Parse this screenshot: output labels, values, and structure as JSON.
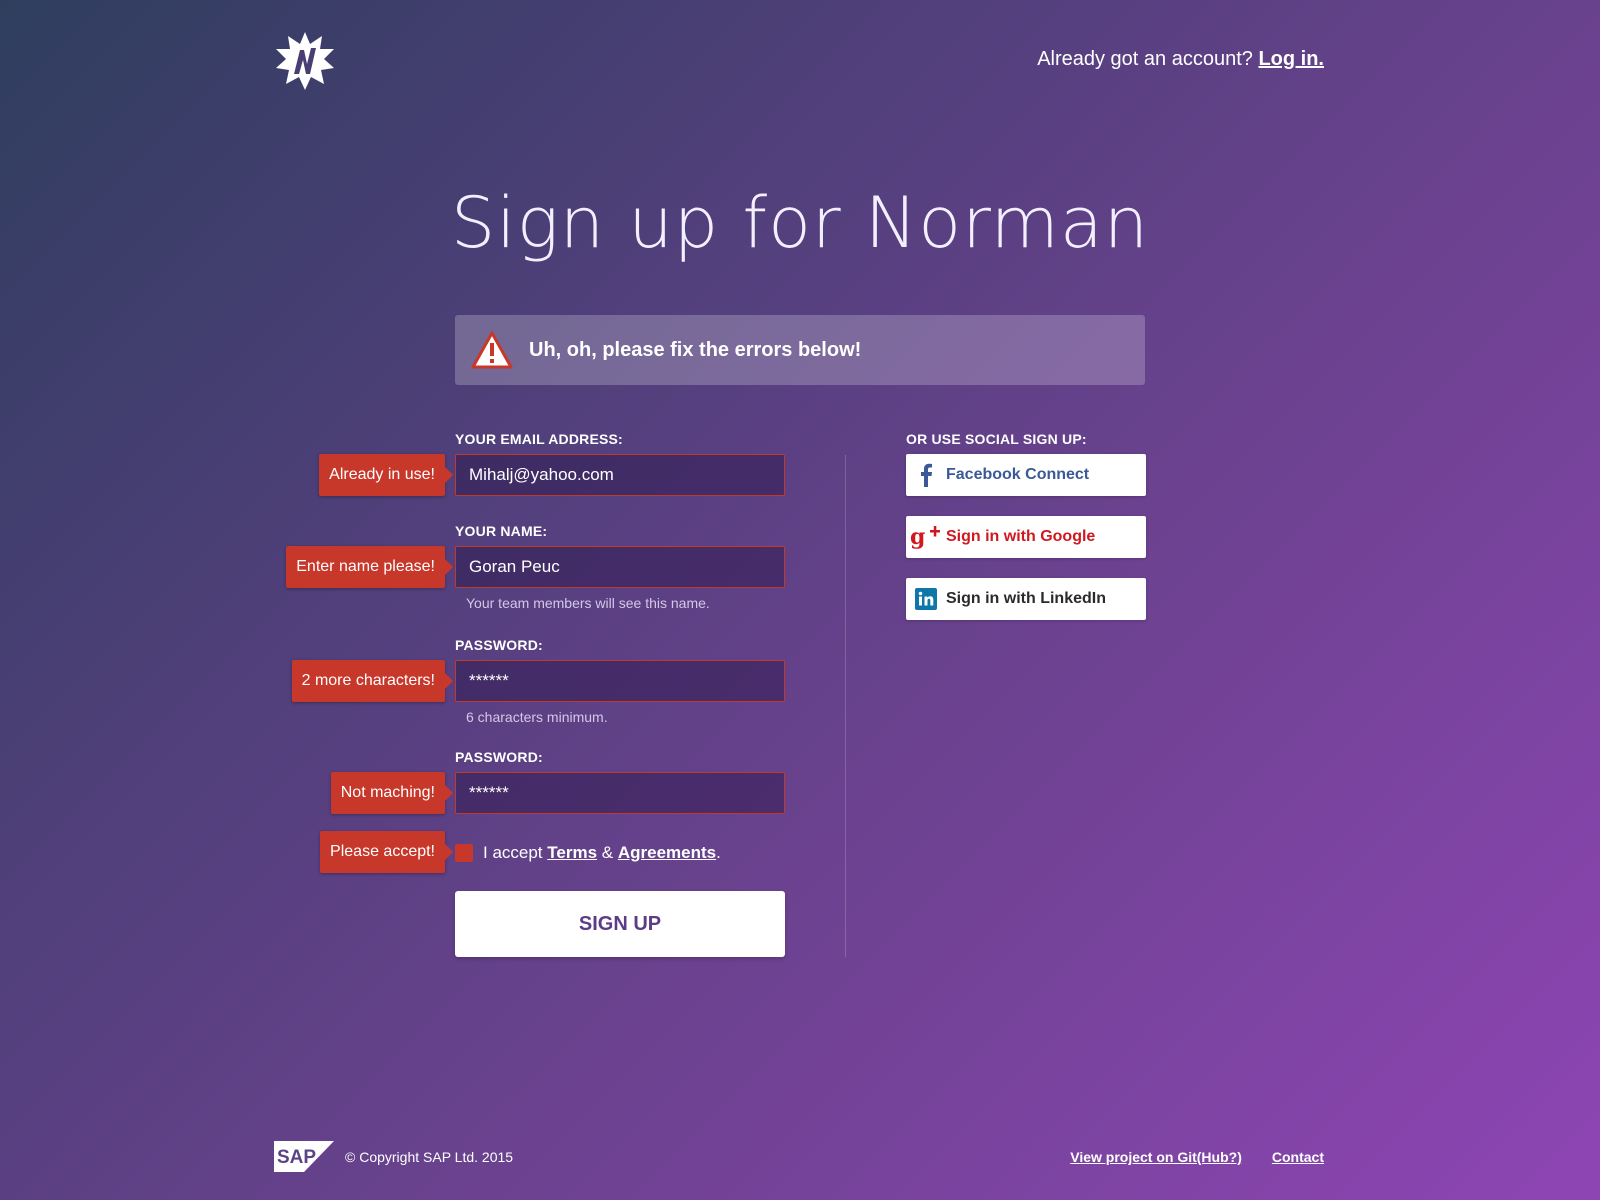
{
  "header": {
    "logo_icon": "norman-burst-logo",
    "account_prompt": "Already got an account?",
    "login_link": "Log in."
  },
  "title": "Sign up for Norman",
  "alert": {
    "icon": "warning-triangle-icon",
    "message": "Uh, oh, please fix the errors below!"
  },
  "form": {
    "email": {
      "label": "YOUR EMAIL ADDRESS:",
      "value": "Mihalj@yahoo.com",
      "error": "Already in use!"
    },
    "name": {
      "label": "YOUR NAME:",
      "value": "Goran Peuc",
      "hint": "Your team members will see this name.",
      "error": "Enter name please!"
    },
    "password": {
      "label": "PASSWORD:",
      "value": "******",
      "hint": "6 characters minimum.",
      "error": "2 more characters!"
    },
    "password_confirm": {
      "label": "PASSWORD:",
      "value": "******",
      "error": "Not maching!"
    },
    "terms": {
      "error": "Please accept!",
      "prefix": "I accept",
      "terms_link": "Terms",
      "amp": "&",
      "agreements_link": "Agreements",
      "suffix": "."
    },
    "submit_label": "SIGN UP"
  },
  "social": {
    "label": "OR USE SOCIAL SIGN UP:",
    "facebook": {
      "label": "Facebook Connect",
      "icon": "facebook-icon",
      "color": "#3b5998"
    },
    "google": {
      "label": "Sign in with Google",
      "icon": "google-plus-icon",
      "color": "#d0191f"
    },
    "linkedin": {
      "label": "Sign in with LinkedIn",
      "icon": "linkedin-icon",
      "color": "#0e76a8"
    }
  },
  "footer": {
    "logo": "SAP",
    "copyright": "© Copyright SAP Ltd. 2015",
    "github_link": "View project on Git(Hub?)",
    "contact_link": "Contact"
  },
  "colors": {
    "error": "#c7372a",
    "accent_text": "#5b3d85"
  }
}
